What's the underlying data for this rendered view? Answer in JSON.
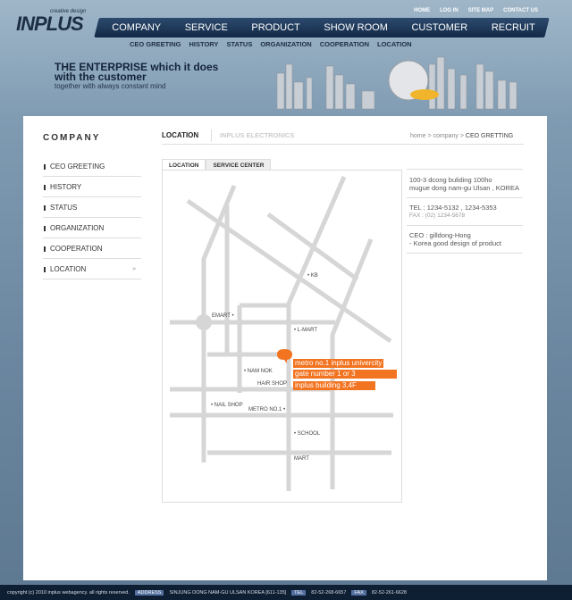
{
  "logo": {
    "text": "INPLUS",
    "tagline": "creative design"
  },
  "util_nav": [
    "HOME",
    "LOG IN",
    "SITE MAP",
    "CONTACT US"
  ],
  "gnb": [
    "COMPANY",
    "SERVICE",
    "PRODUCT",
    "SHOW ROOM",
    "CUSTOMER",
    "RECRUIT"
  ],
  "sub_nav": [
    "CEO GREETING",
    "HISTORY",
    "STATUS",
    "ORGANIZATION",
    "COOPERATION",
    "LOCATION"
  ],
  "slogan": {
    "line1": "THE ENTERPRISE which it does",
    "line2": "with the customer",
    "line3": "together with always constant mind"
  },
  "sidebar": {
    "title": "COMPANY",
    "items": [
      "CEO GREETING",
      "HISTORY",
      "STATUS",
      "ORGANIZATION",
      "COOPERATION",
      "LOCATION"
    ],
    "active_arrow": "»"
  },
  "content": {
    "tab_active": "LOCATION",
    "tab_other": "INPLUS ELECTRONICS",
    "breadcrumb": {
      "home": "home",
      "sep": ">",
      "company": "company",
      "current": "CEO GRETTING"
    },
    "subtabs": [
      "LOCATION",
      "SERVICE CENTER"
    ]
  },
  "info": {
    "address1": "100-3 dcong buliding 100ho",
    "address2": "mugue dong nam-gu Ulsan , KOREA",
    "tel": "TEL : 1234-5132 , 1234-5353",
    "fax": "FAX : (02) 1234-5678",
    "ceo": "CEO : gilldong-Hong",
    "slogan": "- Korea good design of product"
  },
  "map": {
    "labels": [
      "KB",
      "EMART",
      "L-MART",
      "NAM NOK",
      "HAIR SHOP",
      "NAIL SHOP",
      "METRO NO.1",
      "SCHOOL",
      "MART"
    ],
    "callouts": [
      "metro no.1 inplus univercity",
      "gate number 1 or 3",
      "inplus building 3,4F"
    ],
    "accent": "#f27320"
  },
  "footer": {
    "copyright": "copyright (c) 2010 inplus webagency. all rights reserved.",
    "address_label": "ADDRESS",
    "address": "SINJUNG DONG NAM-GU ULSAN KOREA [611-135]",
    "tel_label": "TEL",
    "tel": "82-52-268-6657",
    "fax_label": "FAX",
    "fax": "82-52-261-6628"
  }
}
